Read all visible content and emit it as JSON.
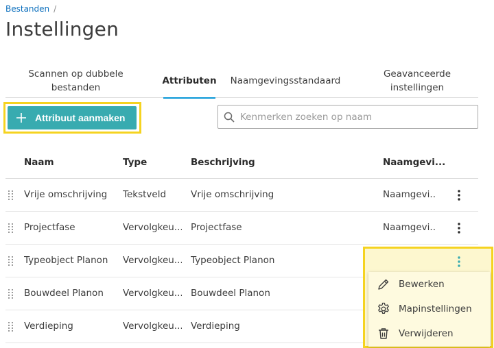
{
  "breadcrumb": {
    "link": "Bestanden",
    "separator": "/"
  },
  "page_title": "Instellingen",
  "tabs": [
    {
      "label": "Scannen op dubbele bestanden",
      "active": false
    },
    {
      "label": "Attributen",
      "active": true
    },
    {
      "label": "Naamgevingsstandaard",
      "active": false
    },
    {
      "label": "Geavanceerde instellingen",
      "active": false
    }
  ],
  "toolbar": {
    "create_label": "Attribuut aanmaken",
    "search_placeholder": "Kenmerken zoeken op naam"
  },
  "table": {
    "headers": {
      "name": "Naam",
      "type": "Type",
      "description": "Beschrijving",
      "convention": "Naamgevi..."
    },
    "rows": [
      {
        "name": "Vrije omschrijving",
        "type": "Tekstveld",
        "description": "Vrije omschrijving",
        "convention": "Naamgevi..."
      },
      {
        "name": "Projectfase",
        "type": "Vervolgkeu...",
        "description": "Projectfase",
        "convention": "Naamgevi..."
      },
      {
        "name": "Typeobject Planon",
        "type": "Vervolgkeu...",
        "description": "Typeobject Planon",
        "convention": ""
      },
      {
        "name": "Bouwdeel Planon",
        "type": "Vervolgkeu...",
        "description": "Bouwdeel Planon",
        "convention": ""
      },
      {
        "name": "Verdieping",
        "type": "Vervolgkeu...",
        "description": "Verdieping",
        "convention": ""
      }
    ]
  },
  "context_menu": {
    "items": [
      {
        "label": "Bewerken",
        "icon": "pencil-icon"
      },
      {
        "label": "Mapinstellingen",
        "icon": "gear-icon"
      },
      {
        "label": "Verwijderen",
        "icon": "trash-icon"
      }
    ]
  },
  "colors": {
    "accent": "#38abb0",
    "tab_underline": "#0696d7",
    "highlight": "#f5d320",
    "link": "#0a6ebd"
  }
}
